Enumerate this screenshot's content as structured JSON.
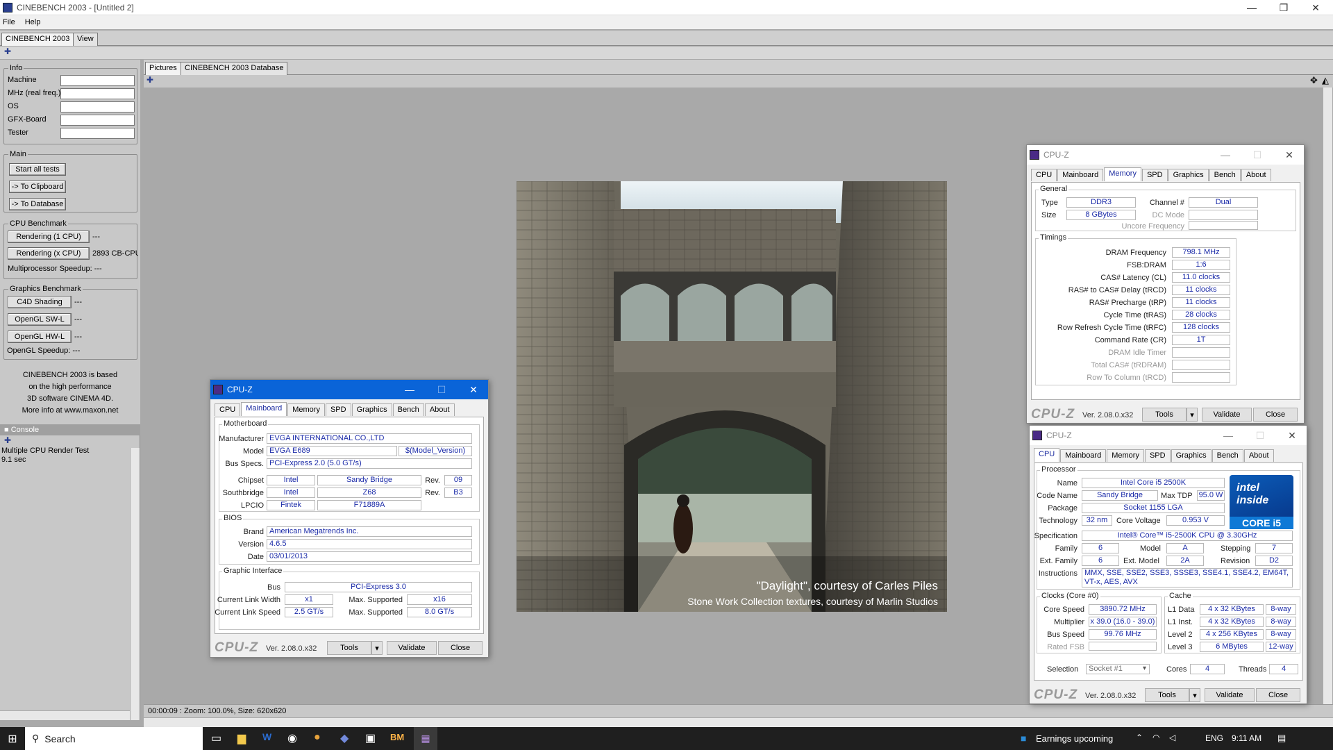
{
  "window": {
    "title": "CINEBENCH 2003 - [Untitled 2]"
  },
  "menu": [
    "File",
    "Help"
  ],
  "main_tabs": [
    "CINEBENCH 2003",
    "View"
  ],
  "info": {
    "group": "Info",
    "fields": [
      "Machine",
      "MHz (real freq.)",
      "OS",
      "GFX-Board",
      "Tester"
    ]
  },
  "main": {
    "group": "Main",
    "buttons": [
      "Start all tests",
      "-> To Clipboard",
      "-> To Database"
    ]
  },
  "cpu_bench": {
    "group": "CPU Benchmark",
    "single_label": "Rendering (1 CPU)",
    "single_value": "---",
    "multi_label": "Rendering (x CPU)",
    "multi_value": "2893 CB-CPU",
    "speedup": "Multiprocessor Speedup:  ---"
  },
  "gfx_bench": {
    "group": "Graphics Benchmark",
    "items": [
      {
        "label": "C4D Shading",
        "value": "---"
      },
      {
        "label": "OpenGL SW-L",
        "value": "---"
      },
      {
        "label": "OpenGL HW-L",
        "value": "---"
      }
    ],
    "speedup": "OpenGL Speedup:  ---"
  },
  "about_text": [
    "CINEBENCH 2003 is based",
    "on the high performance",
    "3D software CINEMA 4D.",
    "More info at www.maxon.net"
  ],
  "console": {
    "title": "Console",
    "lines": [
      "Multiple CPU Render Test",
      "9.1 sec"
    ]
  },
  "right_tabs": [
    "Pictures",
    "CINEBENCH 2003 Database"
  ],
  "render_caption": {
    "line1": "\"Daylight\", courtesy of Carles Piles",
    "line2": "Stone Work Collection textures, courtesy of Marlin Studios"
  },
  "status": "00:00:09 : Zoom: 100.0%, Size: 620x620",
  "cpuz_tabs": [
    "CPU",
    "Mainboard",
    "Memory",
    "SPD",
    "Graphics",
    "Bench",
    "About"
  ],
  "cpuz_common": {
    "title": "CPU-Z",
    "version": "Ver. 2.08.0.x32",
    "tools": "Tools",
    "validate": "Validate",
    "close": "Close",
    "logo": "CPU-Z"
  },
  "mainboard": {
    "motherboard_label": "Motherboard",
    "manufacturer_label": "Manufacturer",
    "manufacturer": "EVGA INTERNATIONAL CO.,LTD",
    "model_label": "Model",
    "model": "EVGA E689",
    "model_version": "$(Model_Version)",
    "bus_label": "Bus Specs.",
    "bus": "PCI-Express 2.0 (5.0 GT/s)",
    "chipset_label": "Chipset",
    "chipset_vendor": "Intel",
    "chipset_name": "Sandy Bridge",
    "chipset_rev_label": "Rev.",
    "chipset_rev": "09",
    "southbridge_label": "Southbridge",
    "sb_vendor": "Intel",
    "sb_name": "Z68",
    "sb_rev_label": "Rev.",
    "sb_rev": "B3",
    "lpcio_label": "LPCIO",
    "lpcio_vendor": "Fintek",
    "lpcio_name": "F71889A",
    "bios_label": "BIOS",
    "brand_label": "Brand",
    "brand": "American Megatrends Inc.",
    "version_label": "Version",
    "version": "4.6.5",
    "date_label": "Date",
    "date": "03/01/2013",
    "gi_label": "Graphic Interface",
    "gi_bus_label": "Bus",
    "gi_bus": "PCI-Express 3.0",
    "clw_label": "Current Link Width",
    "clw": "x1",
    "clw_max_label": "Max. Supported",
    "clw_max": "x16",
    "cls_label": "Current Link Speed",
    "cls": "2.5 GT/s",
    "cls_max_label": "Max. Supported",
    "cls_max": "8.0 GT/s"
  },
  "memory": {
    "general_label": "General",
    "type_label": "Type",
    "type": "DDR3",
    "size_label": "Size",
    "size": "8 GBytes",
    "channel_label": "Channel #",
    "channel": "Dual",
    "dc_label": "DC Mode",
    "uncore_label": "Uncore Frequency",
    "timings_label": "Timings",
    "timings": [
      {
        "label": "DRAM Frequency",
        "value": "798.1 MHz",
        "dim": false
      },
      {
        "label": "FSB:DRAM",
        "value": "1:6",
        "dim": false
      },
      {
        "label": "CAS# Latency (CL)",
        "value": "11.0 clocks",
        "dim": false
      },
      {
        "label": "RAS# to CAS# Delay (tRCD)",
        "value": "11 clocks",
        "dim": false
      },
      {
        "label": "RAS# Precharge (tRP)",
        "value": "11 clocks",
        "dim": false
      },
      {
        "label": "Cycle Time (tRAS)",
        "value": "28 clocks",
        "dim": false
      },
      {
        "label": "Row Refresh Cycle Time (tRFC)",
        "value": "128 clocks",
        "dim": false
      },
      {
        "label": "Command Rate (CR)",
        "value": "1T",
        "dim": false
      },
      {
        "label": "DRAM Idle Timer",
        "value": "",
        "dim": true
      },
      {
        "label": "Total CAS# (tRDRAM)",
        "value": "",
        "dim": true
      },
      {
        "label": "Row To Column (tRCD)",
        "value": "",
        "dim": true
      }
    ]
  },
  "cpu": {
    "processor_label": "Processor",
    "name_label": "Name",
    "name": "Intel Core i5 2500K",
    "codename_label": "Code Name",
    "codename": "Sandy Bridge",
    "tdp_label": "Max TDP",
    "tdp": "95.0 W",
    "package_label": "Package",
    "package": "Socket 1155 LGA",
    "tech_label": "Technology",
    "tech": "32 nm",
    "voltage_label": "Core Voltage",
    "voltage": "0.953 V",
    "spec_label": "Specification",
    "spec": "Intel® Core™ i5-2500K CPU @ 3.30GHz",
    "family_label": "Family",
    "family": "6",
    "model_label": "Model",
    "model": "A",
    "stepping_label": "Stepping",
    "stepping": "7",
    "extfam_label": "Ext. Family",
    "extfam": "6",
    "extmodel_label": "Ext. Model",
    "extmodel": "2A",
    "revision_label": "Revision",
    "revision": "D2",
    "instr_label": "Instructions",
    "instr": "MMX, SSE, SSE2, SSE3, SSSE3, SSE4.1, SSE4.2, EM64T, VT-x, AES, AVX",
    "clocks_label": "Clocks (Core #0)",
    "speed_label": "Core Speed",
    "speed": "3890.72 MHz",
    "mult_label": "Multiplier",
    "mult": "x 39.0 (16.0 - 39.0)",
    "bus_label": "Bus Speed",
    "bus": "99.76 MHz",
    "fsb_label": "Rated FSB",
    "cache_label": "Cache",
    "cache": [
      {
        "label": "L1 Data",
        "size": "4 x 32 KBytes",
        "way": "8-way"
      },
      {
        "label": "L1 Inst.",
        "size": "4 x 32 KBytes",
        "way": "8-way"
      },
      {
        "label": "Level 2",
        "size": "4 x 256 KBytes",
        "way": "8-way"
      },
      {
        "label": "Level 3",
        "size": "6 MBytes",
        "way": "12-way"
      }
    ],
    "selection_label": "Selection",
    "selection": "Socket #1",
    "cores_label": "Cores",
    "cores": "4",
    "threads_label": "Threads",
    "threads": "4",
    "intel_inside": "intel inside",
    "intel_brand": "CORE i5"
  },
  "taskbar": {
    "search": "Search",
    "news": "Earnings upcoming",
    "lang": "ENG",
    "time": "9:11 AM"
  },
  "colors": {
    "value_blue": "#1a2aa8",
    "active_title": "#0a64d8"
  }
}
